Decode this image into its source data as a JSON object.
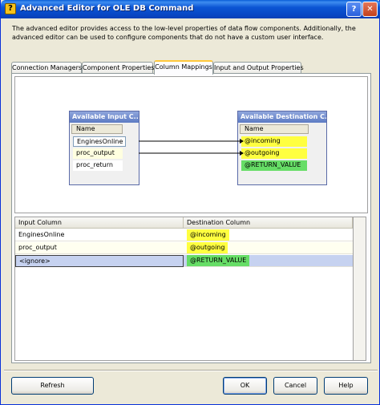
{
  "window": {
    "title": "Advanced Editor for OLE DB Command",
    "help_glyph": "?",
    "close_glyph": "✕",
    "app_icon_glyph": "?"
  },
  "description": "The advanced editor provides access to the low-level properties of data flow components. Additionally, the advanced editor can be used to configure components that do not have a custom user interface.",
  "tabs": [
    {
      "label": "Connection Managers",
      "active": false
    },
    {
      "label": "Component Properties",
      "active": false
    },
    {
      "label": "Column Mappings",
      "active": true
    },
    {
      "label": "Input and Output Properties",
      "active": false
    }
  ],
  "diagram": {
    "input_box": {
      "title": "Available Input C...",
      "column_header": "Name",
      "rows": [
        "EnginesOnline",
        "proc_output",
        "proc_return"
      ]
    },
    "dest_box": {
      "title": "Available Destination C...",
      "column_header": "Name",
      "rows": [
        "@incoming",
        "@outgoing",
        "@RETURN_VALUE"
      ]
    }
  },
  "grid": {
    "headers": [
      "Input Column",
      "Destination Column"
    ],
    "rows": [
      {
        "input": "EnginesOnline",
        "destination": "@incoming"
      },
      {
        "input": "proc_output",
        "destination": "@outgoing"
      },
      {
        "input": "<ignore>",
        "destination": "@RETURN_VALUE"
      }
    ]
  },
  "buttons": {
    "refresh": "Refresh",
    "ok": "OK",
    "cancel": "Cancel",
    "help": "Help"
  },
  "colors": {
    "mapped_highlight": "#ffff40",
    "return_value_highlight": "#66dd66",
    "title_bar": "#0a52d0"
  }
}
